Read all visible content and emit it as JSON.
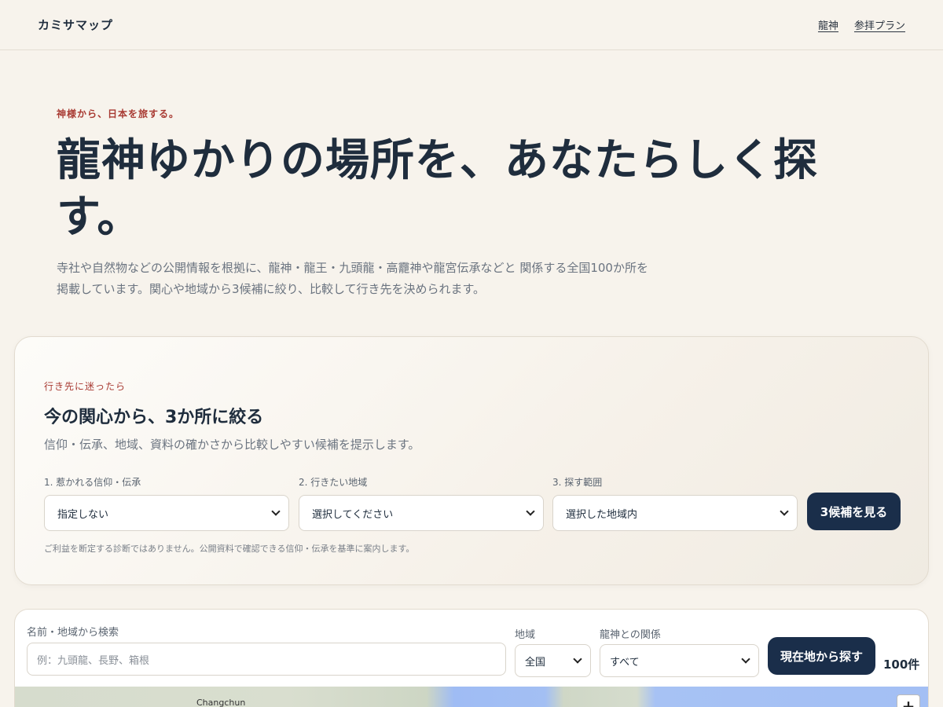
{
  "header": {
    "brand": "カミサマップ",
    "nav": [
      "龍神",
      "参拝プラン"
    ]
  },
  "hero": {
    "eyebrow": "神様から、日本を旅する。",
    "title": "龍神ゆかりの場所を、あなたらしく探す。",
    "description": "寺社や自然物などの公開情報を根拠に、龍神・龍王・九頭龍・高龗神や龍宮伝承などと 関係する全国100か所を掲載しています。関心や地域から3候補に絞り、比較して行き先を決められます。"
  },
  "diagnosis": {
    "eyebrow": "行き先に迷ったら",
    "title": "今の関心から、3か所に絞る",
    "subtitle": "信仰・伝承、地域、資料の確かさから比較しやすい候補を提示します。",
    "fields": [
      {
        "label": "1. 惹かれる信仰・伝承",
        "value": "指定しない"
      },
      {
        "label": "2. 行きたい地域",
        "value": "選択してください"
      },
      {
        "label": "3. 探す範囲",
        "value": "選択した地域内"
      }
    ],
    "button": "3候補を見る",
    "note": "ご利益を断定する診断ではありません。公開資料で確認できる信仰・伝承を基準に案内します。"
  },
  "search": {
    "name_label": "名前・地域から検索",
    "name_placeholder": "例：九頭龍、長野、箱根",
    "region_label": "地域",
    "region_value": "全国",
    "relation_label": "龍神との関係",
    "relation_value": "すべて",
    "locate_button": "現在地から探す",
    "count": "100件"
  },
  "map": {
    "city_label": "Changchun",
    "zoom_in": "+"
  }
}
